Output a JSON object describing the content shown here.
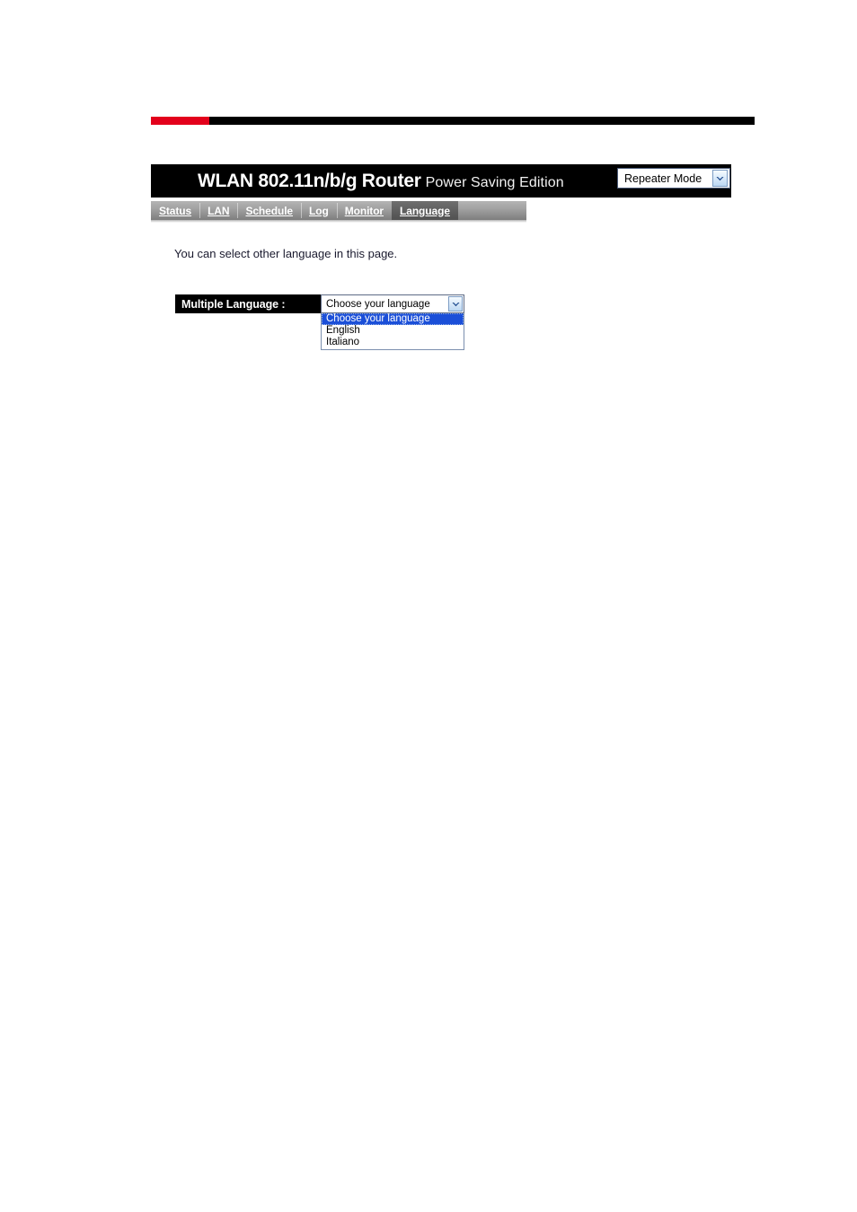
{
  "decor": {
    "rule_red_color": "#e3001b",
    "rule_black_color": "#000000"
  },
  "header": {
    "brand_main": "WLAN 802.11n/b/g Router",
    "brand_sub": "Power Saving Edition",
    "mode_select": {
      "value": "Repeater Mode",
      "arrow_icon": "chevron-down-icon"
    }
  },
  "nav": {
    "items": [
      {
        "label": "Status",
        "active": false
      },
      {
        "label": "LAN",
        "active": false
      },
      {
        "label": "Schedule",
        "active": false
      },
      {
        "label": "Log",
        "active": false
      },
      {
        "label": "Monitor",
        "active": false
      },
      {
        "label": "Language",
        "active": true
      }
    ]
  },
  "main": {
    "note": "You can select other language in this page.",
    "language_row": {
      "label": "Multiple Language :",
      "select": {
        "value": "Choose your language",
        "arrow_icon": "chevron-down-icon",
        "expanded": true,
        "options": [
          {
            "label": "Choose your language",
            "selected": true
          },
          {
            "label": "English",
            "selected": false
          },
          {
            "label": "Italiano",
            "selected": false
          }
        ],
        "highlight_color": "#1b4fd8"
      }
    }
  }
}
